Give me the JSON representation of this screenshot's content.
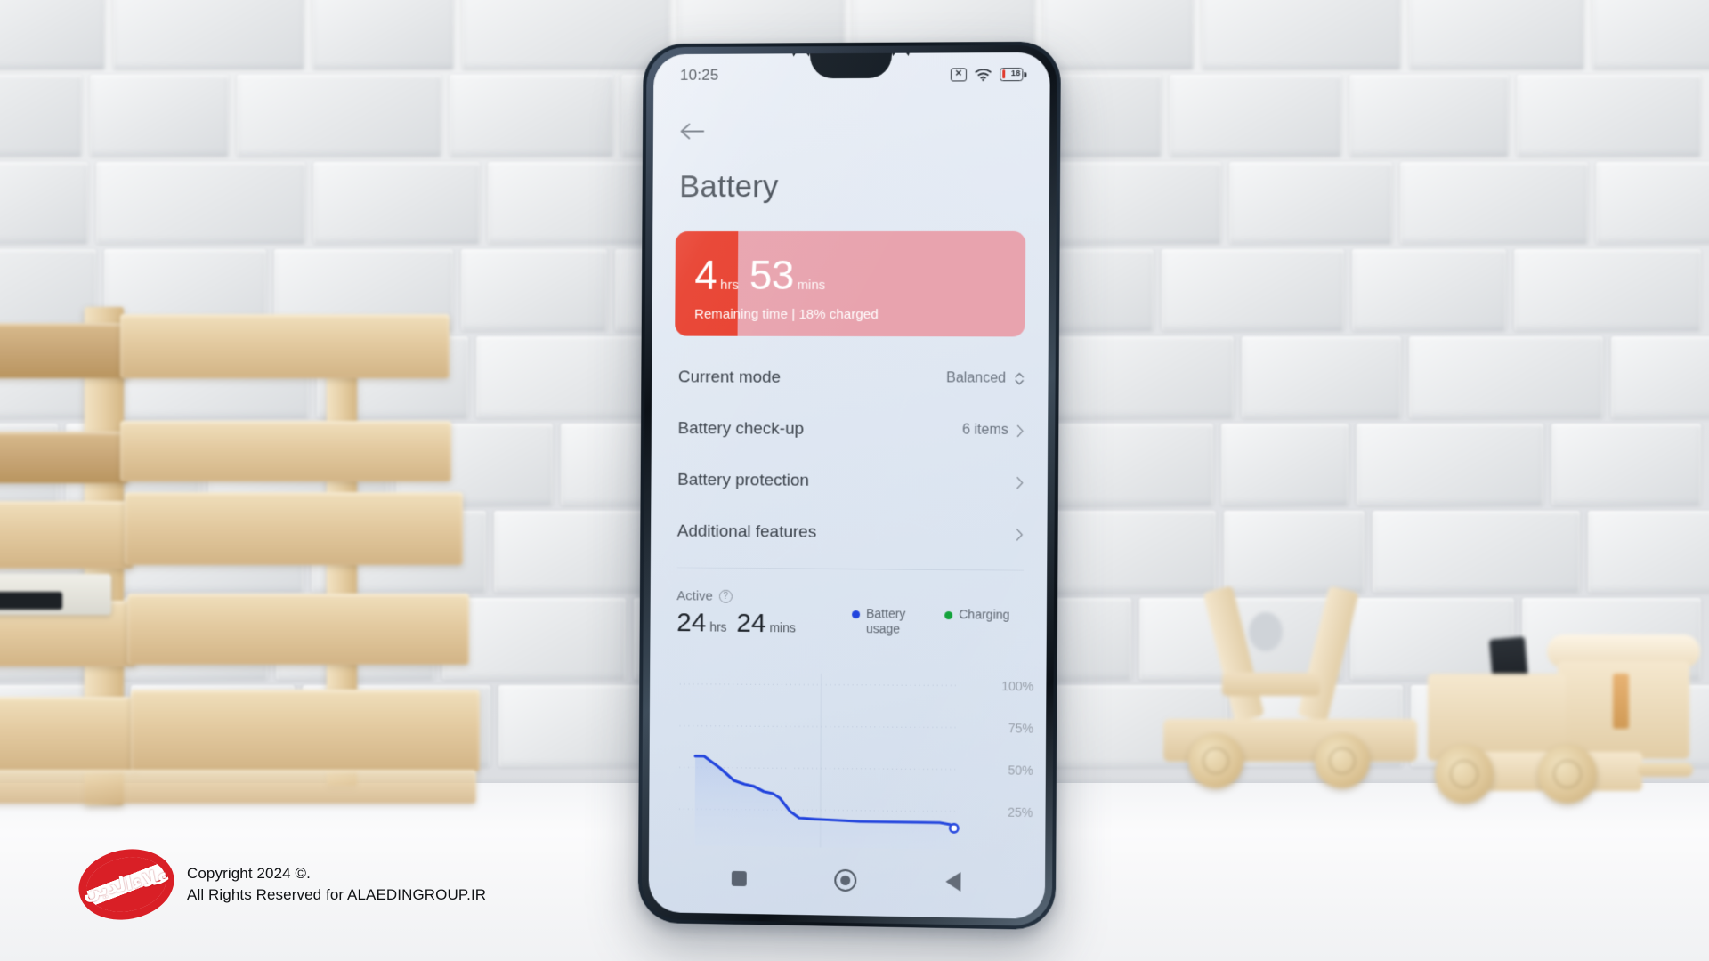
{
  "scene": {
    "description": "smartphone on white desk in front of grey brick wall with wooden crate and wooden toys"
  },
  "phone": {
    "statusbar": {
      "time": "10:25",
      "icons": [
        {
          "name": "sim-no-service-icon",
          "glyph": "x"
        },
        {
          "name": "wifi-icon",
          "glyph": "wifi"
        },
        {
          "name": "battery-icon",
          "level": "18"
        }
      ]
    },
    "nav": {
      "back_arrow": "back-arrow-icon",
      "title": "Battery"
    },
    "battery_card": {
      "hours": "4",
      "hours_unit": "hrs",
      "minutes": "53",
      "minutes_unit": "mins",
      "subtitle": "Remaining time | 18% charged",
      "charged_percent": 18,
      "fill_color": "#e8402f",
      "track_color": "#e8a3ae"
    },
    "settings_rows": [
      {
        "label": "Current mode",
        "value": "Balanced",
        "control": "updown"
      },
      {
        "label": "Battery check-up",
        "value": "6 items",
        "control": "chevron"
      },
      {
        "label": "Battery protection",
        "value": "",
        "control": "chevron"
      },
      {
        "label": "Additional features",
        "value": "",
        "control": "chevron"
      }
    ],
    "active_section": {
      "label": "Active",
      "info_icon": "question-mark-icon",
      "hours": "24",
      "hours_unit": "hrs",
      "minutes": "24",
      "minutes_unit": "mins",
      "legend": [
        {
          "label": "Battery usage",
          "color": "#2244dd"
        },
        {
          "label": "Charging",
          "color": "#14a33c"
        }
      ]
    },
    "navbar": [
      {
        "name": "recents-button",
        "icon": "square-icon"
      },
      {
        "name": "home-button",
        "icon": "circle-icon"
      },
      {
        "name": "back-button",
        "icon": "triangle-left-icon"
      }
    ]
  },
  "chart_data": {
    "type": "line",
    "title": "",
    "xlabel": "",
    "ylabel": "",
    "ylim": [
      0,
      100
    ],
    "ytick_labels": [
      "100%",
      "75%",
      "50%",
      "25%"
    ],
    "yticks": [
      100,
      75,
      50,
      25
    ],
    "grid": true,
    "legend_position": "top-right",
    "line_color": "#2244dd",
    "area_fill": "#c3d2ef",
    "endpoint_marker": {
      "value": 18,
      "style": "hollow-circle"
    },
    "series": [
      {
        "name": "Battery usage",
        "color": "#2244dd",
        "x": [
          0,
          3,
          8,
          12,
          15,
          18,
          22,
          26,
          30,
          34,
          38,
          44,
          52,
          62,
          74,
          86,
          95,
          100
        ],
        "values": [
          57,
          57,
          52,
          45,
          43,
          42,
          39,
          38,
          36,
          28,
          21,
          20,
          19.5,
          19,
          19,
          19,
          19,
          18
        ]
      }
    ]
  },
  "watermark": {
    "logo_script": "علاءالدین",
    "line1": "Copyright 2024 ©.",
    "line2": "All Rights Reserved for ALAEDINGROUP.IR",
    "logo_color": "#d91f26"
  }
}
